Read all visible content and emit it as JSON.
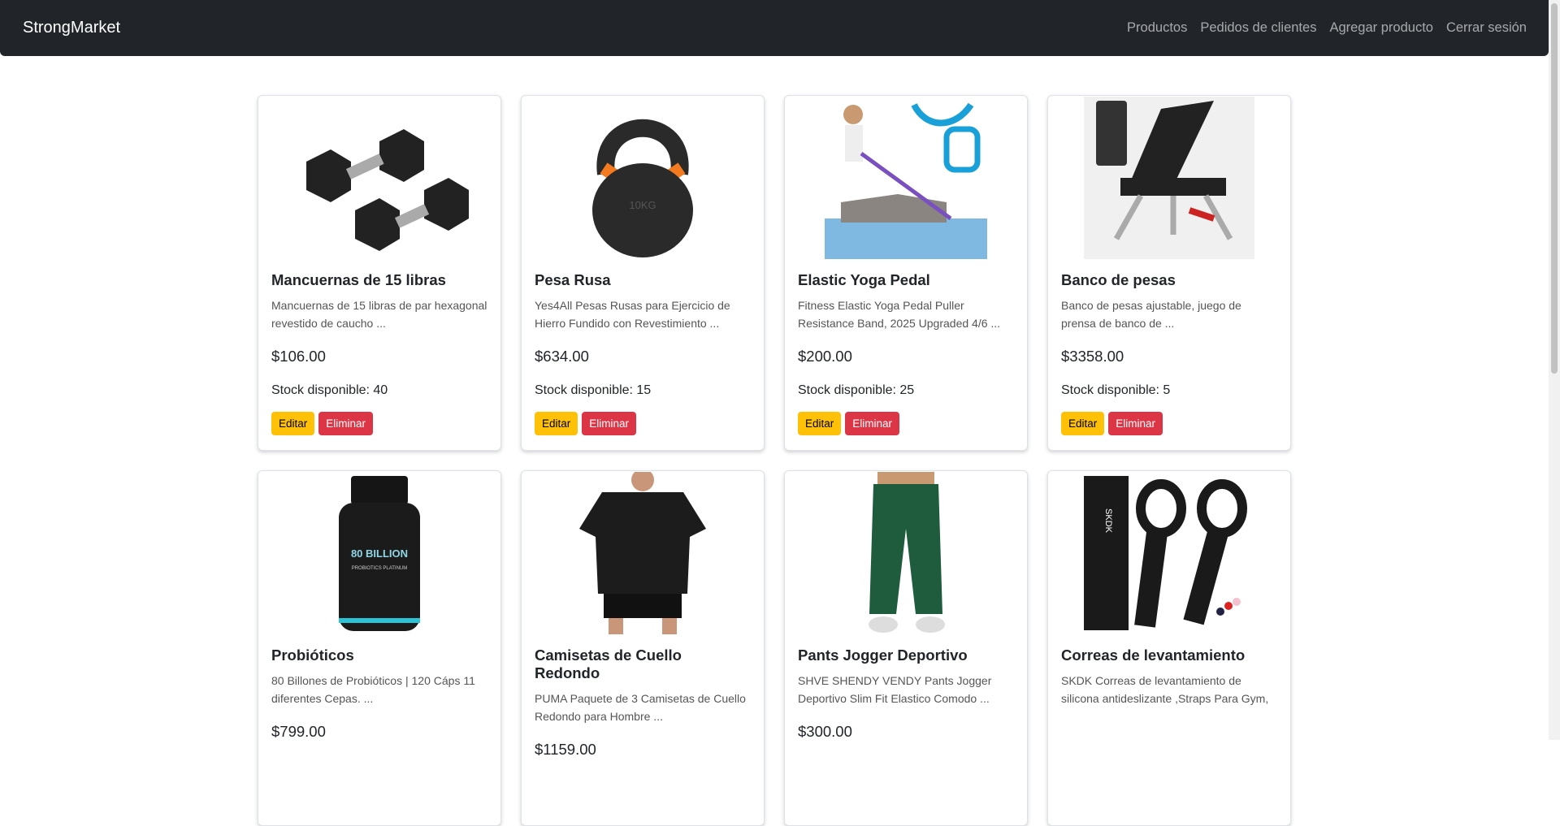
{
  "navbar": {
    "brand": "StrongMarket",
    "links": [
      "Productos",
      "Pedidos de clientes",
      "Agregar producto",
      "Cerrar sesión"
    ]
  },
  "products": [
    {
      "name": "Mancuernas de 15 libras",
      "description": "Mancuernas de 15 libras de par hexagonal revestido de caucho ...",
      "price": "$106.00",
      "stock": "Stock disponible: 40",
      "image": "dumbbell-image"
    },
    {
      "name": "Pesa Rusa",
      "description": "Yes4All Pesas Rusas para Ejercicio de Hierro Fundido con Revestimiento ...",
      "price": "$634.00",
      "stock": "Stock disponible: 15",
      "image": "kettlebell-image"
    },
    {
      "name": "Elastic Yoga Pedal",
      "description": "Fitness Elastic Yoga Pedal Puller Resistance Band, 2025 Upgraded 4/6 ...",
      "price": "$200.00",
      "stock": "Stock disponible: 25",
      "image": "yoga-pedal-image"
    },
    {
      "name": "Banco de pesas",
      "description": "Banco de pesas ajustable, juego de prensa de banco de ...",
      "price": "$3358.00",
      "stock": "Stock disponible: 5",
      "image": "weight-bench-image"
    },
    {
      "name": "Probióticos",
      "description": "80 Billones de Probióticos | 120 Cáps 11 diferentes Cepas. ...",
      "price": "$799.00",
      "stock": "",
      "image": "probiotics-bottle-image"
    },
    {
      "name": "Camisetas de Cuello Redondo",
      "description": "PUMA Paquete de 3 Camisetas de Cuello Redondo para Hombre ...",
      "price": "$1159.00",
      "stock": "",
      "image": "tshirt-image"
    },
    {
      "name": "Pants Jogger Deportivo",
      "description": "SHVE SHENDY VENDY Pants Jogger Deportivo Slim Fit Elastico Comodo ...",
      "price": "$300.00",
      "stock": "",
      "image": "jogger-pants-image"
    },
    {
      "name": "Correas de levantamiento",
      "description": "SKDK Correas de levantamiento de silicona antideslizante ,Straps Para Gym, ...",
      "price": "",
      "stock": "",
      "image": "lifting-straps-image"
    }
  ],
  "buttons": {
    "edit": "Editar",
    "delete": "Eliminar"
  },
  "image_text": {
    "bottle": "80 BILLION",
    "bottle_sub": "PROBIOTICS PLATINUM",
    "kettlebell": "10KG",
    "straps": "SKDK"
  },
  "colors": {
    "navbar": "#212529",
    "edit": "#ffc107",
    "delete": "#dc3545"
  }
}
